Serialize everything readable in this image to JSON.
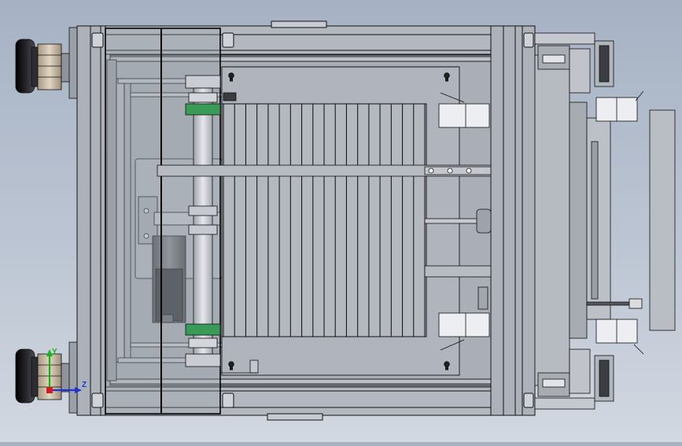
{
  "window": {
    "background_top": "#a6b2c4",
    "background_bottom": "#d2d8e1"
  },
  "model": {
    "line_color": "#111111",
    "frame_color": "#a9aeb6",
    "accent_green": "#3a9a57",
    "foot_color": "#16161a",
    "coupler_color": "#c9b49a",
    "pleat_count": 19,
    "slots_left_rail": 4
  },
  "triad": {
    "y_label": "Y",
    "z_label": "Z",
    "y_color": "#12b31a",
    "z_color": "#1f33d6",
    "x_color": "#d41c1c"
  }
}
